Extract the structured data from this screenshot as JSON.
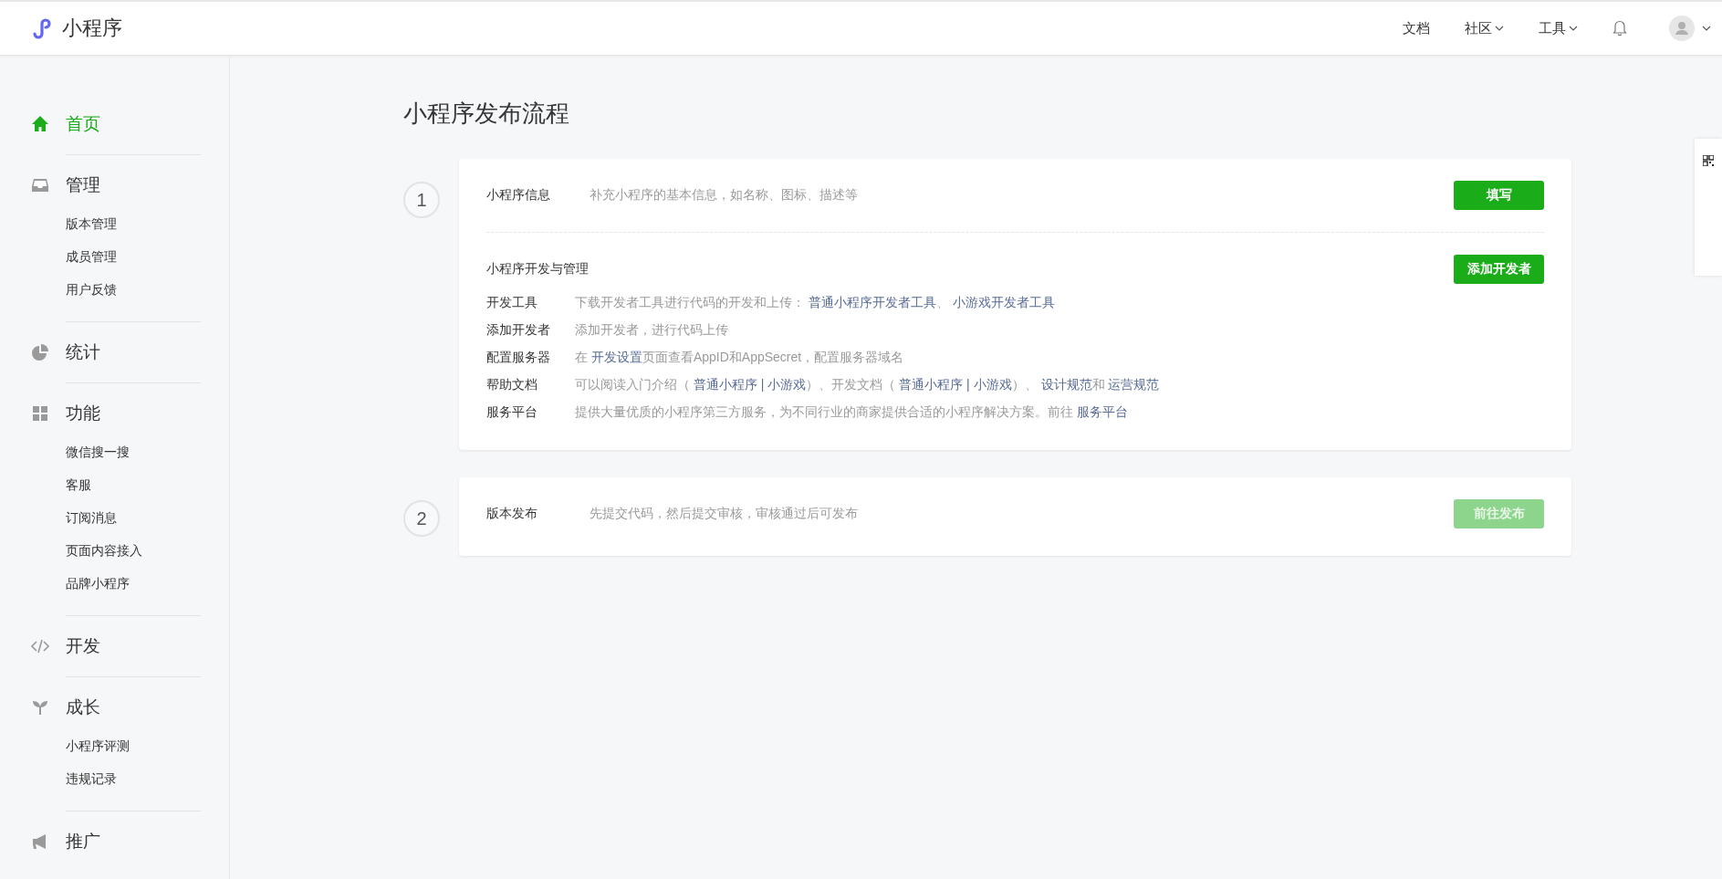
{
  "header": {
    "logo_text": "小程序",
    "nav": [
      {
        "label": "文档",
        "kind": "link"
      },
      {
        "label": "社区",
        "kind": "dropdown"
      },
      {
        "label": "工具",
        "kind": "dropdown"
      }
    ]
  },
  "sidebar": {
    "items": [
      {
        "label": "首页",
        "selected": true
      },
      {
        "label": "管理",
        "selected": false,
        "children": [
          {
            "label": "版本管理"
          },
          {
            "label": "成员管理"
          },
          {
            "label": "用户反馈"
          }
        ]
      },
      {
        "label": "统计",
        "selected": false
      },
      {
        "label": "功能",
        "selected": false,
        "children": [
          {
            "label": "微信搜一搜"
          },
          {
            "label": "客服"
          },
          {
            "label": "订阅消息"
          },
          {
            "label": "页面内容接入"
          },
          {
            "label": "品牌小程序"
          }
        ]
      },
      {
        "label": "开发",
        "selected": false
      },
      {
        "label": "成长",
        "selected": false,
        "children": [
          {
            "label": "小程序评测"
          },
          {
            "label": "违规记录"
          }
        ]
      },
      {
        "label": "推广",
        "selected": false
      }
    ]
  },
  "page_title": "小程序发布流程",
  "steps": [
    {
      "number": "1",
      "blocks": [
        {
          "kind": "info",
          "title": "小程序信息",
          "description": "补充小程序的基本信息，如名称、图标、描述等",
          "button": {
            "label": "填写",
            "disabled": false
          }
        },
        {
          "kind": "list",
          "title": "小程序开发与管理",
          "button": {
            "label": "添加开发者",
            "disabled": false
          },
          "rows": [
            {
              "label": "开发工具",
              "parts": [
                {
                  "text": "下载开发者工具进行代码的开发和上传： ",
                  "link": false
                },
                {
                  "text": "普通小程序开发者工具",
                  "link": true
                },
                {
                  "text": "、 ",
                  "link": false
                },
                {
                  "text": "小游戏开发者工具",
                  "link": true
                }
              ]
            },
            {
              "label": "添加开发者",
              "parts": [
                {
                  "text": "添加开发者，进行代码上传",
                  "link": false
                }
              ]
            },
            {
              "label": "配置服务器",
              "parts": [
                {
                  "text": "在 ",
                  "link": false
                },
                {
                  "text": "开发设置",
                  "link": true
                },
                {
                  "text": "页面查看AppID和AppSecret，配置服务器域名",
                  "link": false
                }
              ]
            },
            {
              "label": "帮助文档",
              "parts": [
                {
                  "text": "可以阅读入门介绍（ ",
                  "link": false
                },
                {
                  "text": "普通小程序 | 小游戏",
                  "link": true
                },
                {
                  "text": "）、开发文档（ ",
                  "link": false
                },
                {
                  "text": "普通小程序 | 小游戏",
                  "link": true
                },
                {
                  "text": "）、 ",
                  "link": false
                },
                {
                  "text": "设计规范",
                  "link": true
                },
                {
                  "text": "和 ",
                  "link": false
                },
                {
                  "text": "运营规范",
                  "link": true
                }
              ]
            },
            {
              "label": "服务平台",
              "parts": [
                {
                  "text": "提供大量优质的小程序第三方服务，为不同行业的商家提供合适的小程序解决方案。前往 ",
                  "link": false
                },
                {
                  "text": "服务平台",
                  "link": true
                }
              ]
            }
          ]
        }
      ]
    },
    {
      "number": "2",
      "blocks": [
        {
          "kind": "info",
          "title": "版本发布",
          "description": "先提交代码，然后提交审核，审核通过后可发布",
          "button": {
            "label": "前往发布",
            "disabled": true
          }
        }
      ]
    }
  ]
}
